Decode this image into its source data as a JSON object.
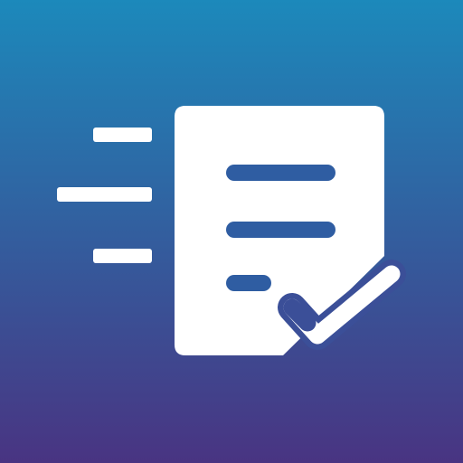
{
  "icon": {
    "name": "fast-document-approval",
    "colors": {
      "gradient_top": "#1c89bb",
      "gradient_bottom": "#493482",
      "foreground": "#ffffff",
      "document_lines": "#2f5da2",
      "check_fold": "#3b4f98"
    }
  }
}
